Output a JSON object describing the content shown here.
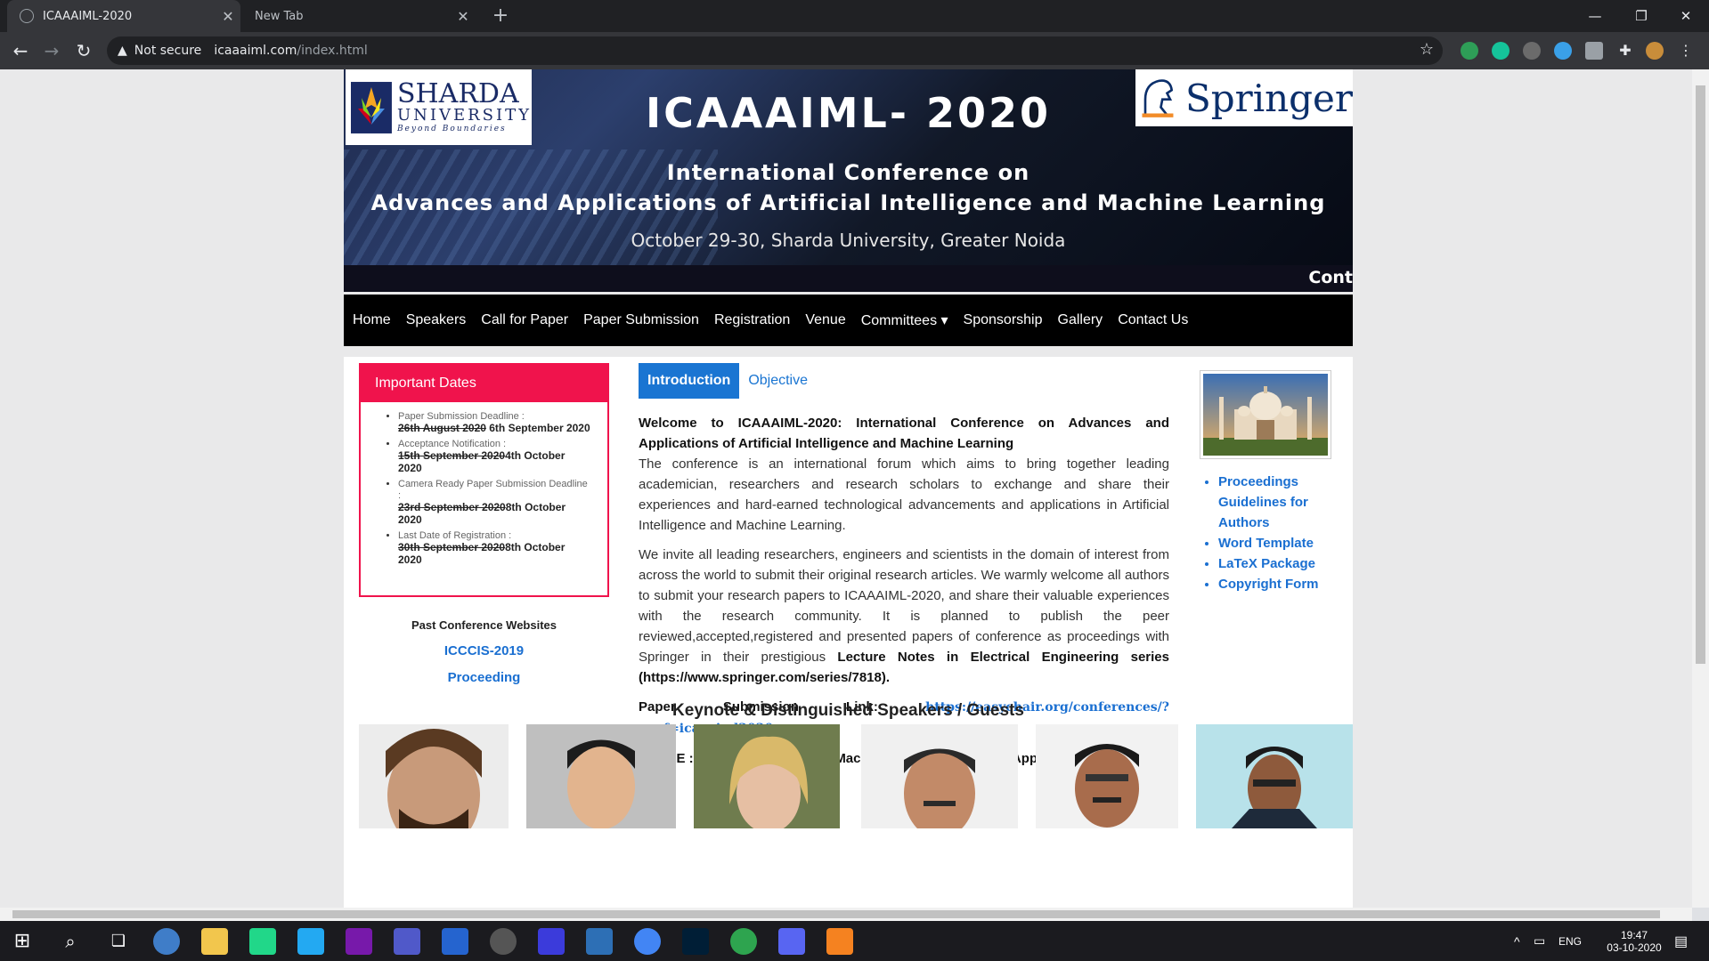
{
  "browser": {
    "tabs": [
      {
        "title": "ICAAAIML-2020",
        "active": true
      },
      {
        "title": "New Tab",
        "active": false
      }
    ],
    "security_label": "Not secure",
    "url_host": "icaaaiml.com",
    "url_path": "/index.html"
  },
  "banner": {
    "title": "ICAAAIML- 2020",
    "subtitle_line1": "International Conference on",
    "subtitle_line2": "Advances and Applications of Artificial Intelligence and Machine Learning",
    "date_venue": "October 29-30, Sharda University, Greater Noida",
    "marquee": "Cont",
    "left_logo": {
      "line1": "SHARDA",
      "line2": "UNIVERSITY",
      "line3": "Beyond Boundaries"
    },
    "right_logo": "Springer"
  },
  "nav": {
    "items": [
      "Home",
      "Speakers",
      "Call for Paper",
      "Paper Submission",
      "Registration",
      "Venue",
      "Committees ▾",
      "Sponsorship",
      "Gallery",
      "Contact Us"
    ]
  },
  "important_dates": {
    "heading": "Important Dates",
    "items": [
      {
        "label": "Paper Submission Deadline :",
        "old": "26th August 2020",
        "new": " 6th September 2020"
      },
      {
        "label": "Acceptance Notification :",
        "old": "15th September 2020",
        "new": "4th October 2020"
      },
      {
        "label": "Camera Ready Paper Submission Deadline :",
        "old": "23rd September 2020",
        "new": "8th October 2020"
      },
      {
        "label": "Last Date of Registration :",
        "old": "30th September 2020",
        "new": "8th October 2020"
      }
    ]
  },
  "past": {
    "title": "Past Conference Websites",
    "links": [
      "ICCCIS-2019",
      "Proceeding"
    ]
  },
  "content_tabs": [
    "Introduction",
    "Objective"
  ],
  "intro": {
    "welcome": "Welcome to ICAAAIML-2020: International Conference on Advances and Applications of Artificial Intelligence and Machine Learning",
    "para1": "The conference is an international forum which aims to bring together leading academician, researchers and research scholars to exchange and share their experiences and hard-earned technological advancements and applications in Artificial Intelligence and Machine Learning.",
    "para2_start": "We invite all leading researchers, engineers and scientists in the domain of interest from across the world to submit their original research articles. We warmly welcome all authors to submit your research papers to ICAAAIML-2020, and share their valuable experiences with the research community. It is planned to publish the peer reviewed,accepted,registered and presented papers of conference as proceedings with Springer in their prestigious ",
    "para2_bold": "Lecture Notes in Electrical Engineering series (https://www.springer.com/series/7818).",
    "submission_label": "Paper Submission Link: ",
    "submission_url": "https://easychair.org/conferences/?conf=icaaaiml2020",
    "theme": "THEME : Artificial Intelligence ,Machine Learning and their Applications"
  },
  "side_links": [
    "Proceedings Guidelines for Authors",
    "Word Template",
    "LaTeX Package",
    "Copyright Form"
  ],
  "speakers_title": "Keynote & Distinguished Speakers / Guests",
  "taskbar": {
    "lang": "ENG",
    "time": "19:47",
    "date": "03-10-2020"
  },
  "colors": {
    "accent_blue": "#1a75d2",
    "dates_red": "#f0134c",
    "nav_black": "#000000"
  }
}
